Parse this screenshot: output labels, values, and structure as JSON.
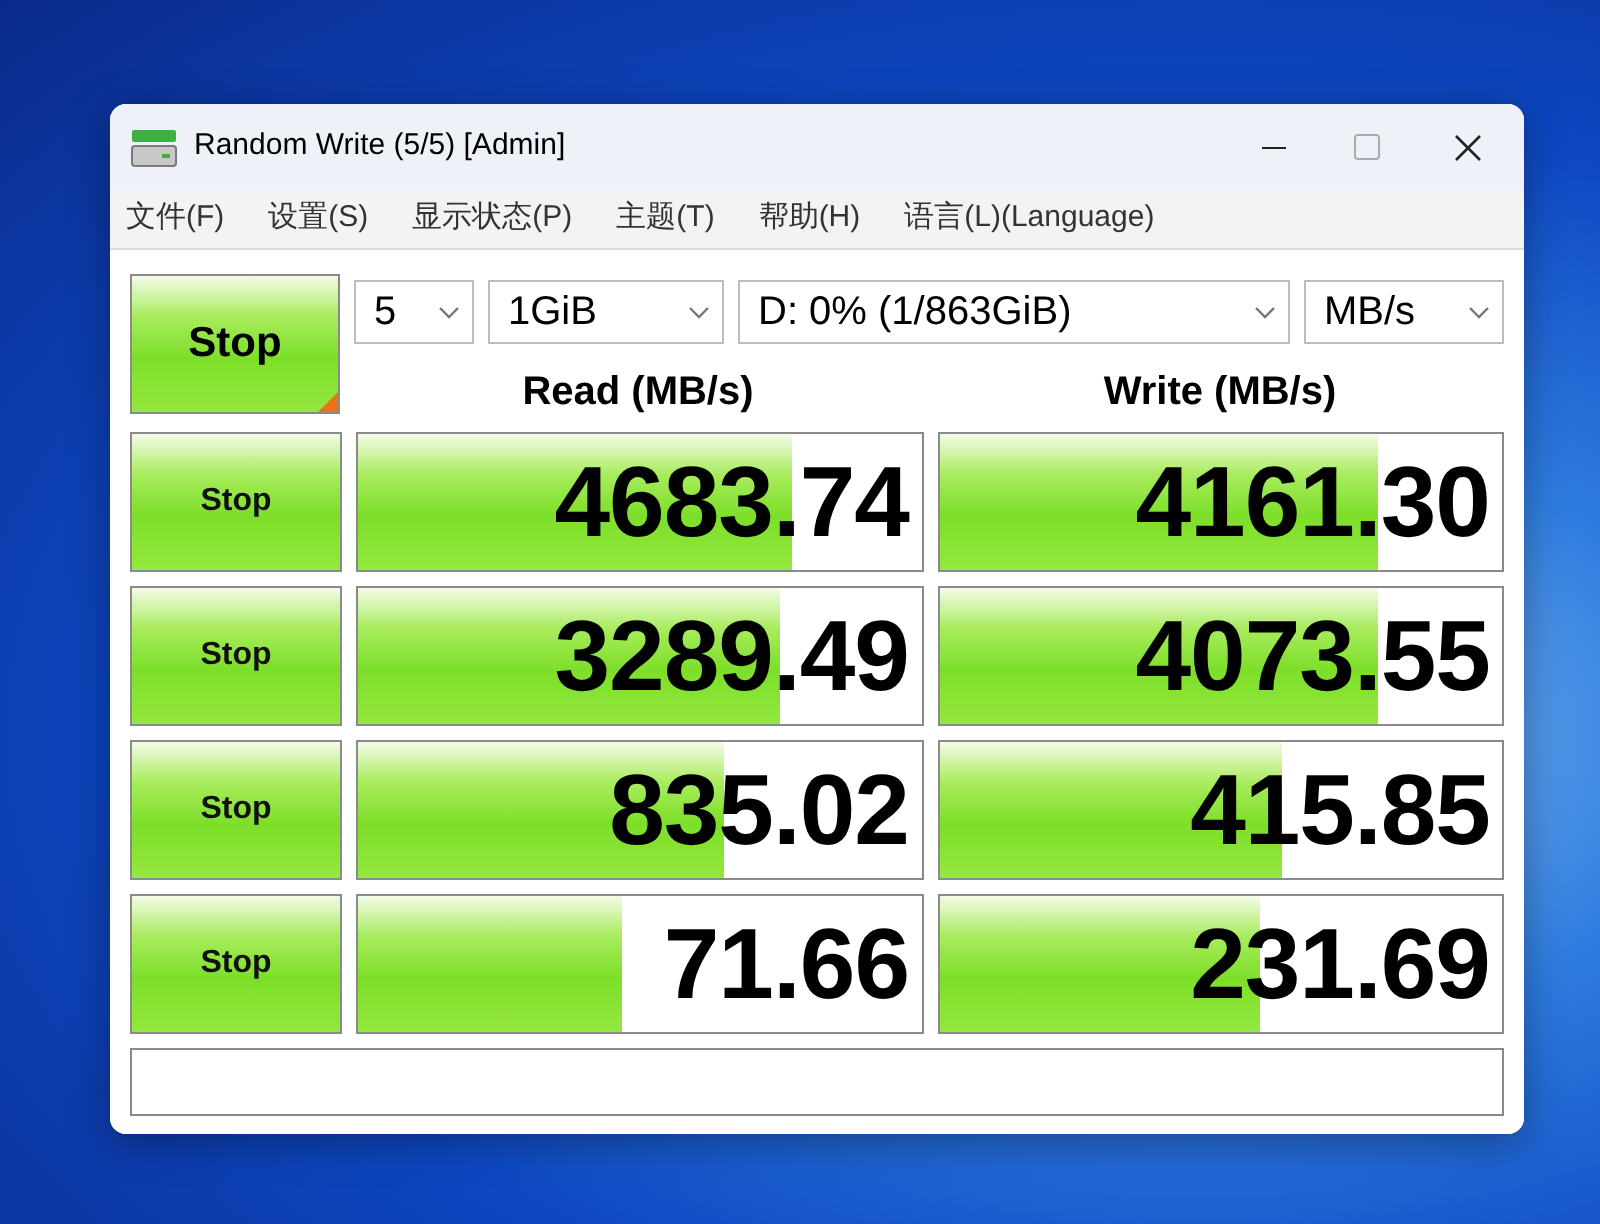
{
  "window": {
    "title": "Random Write (5/5) [Admin]"
  },
  "menu": [
    "文件(F)",
    "设置(S)",
    "显示状态(P)",
    "主题(T)",
    "帮助(H)",
    "语言(L)(Language)"
  ],
  "all_button": {
    "label": "Stop"
  },
  "selectors": [
    {
      "value": "5"
    },
    {
      "value": "1GiB"
    },
    {
      "value": "D: 0% (1/863GiB)"
    },
    {
      "value": "MB/s"
    }
  ],
  "columns": [
    "Read (MB/s)",
    "Write (MB/s)"
  ],
  "rows": [
    {
      "button": "Stop",
      "read": {
        "value": "4683.74",
        "level": 0.77
      },
      "write": {
        "value": "4161.30",
        "level": 0.78
      }
    },
    {
      "button": "Stop",
      "read": {
        "value": "3289.49",
        "level": 0.75
      },
      "write": {
        "value": "4073.55",
        "level": 0.78
      }
    },
    {
      "button": "Stop",
      "read": {
        "value": "835.02",
        "level": 0.65
      },
      "write": {
        "value": "415.85",
        "level": 0.61
      }
    },
    {
      "button": "Stop",
      "read": {
        "value": "71.66",
        "level": 0.47
      },
      "write": {
        "value": "231.69",
        "level": 0.57
      }
    }
  ]
}
